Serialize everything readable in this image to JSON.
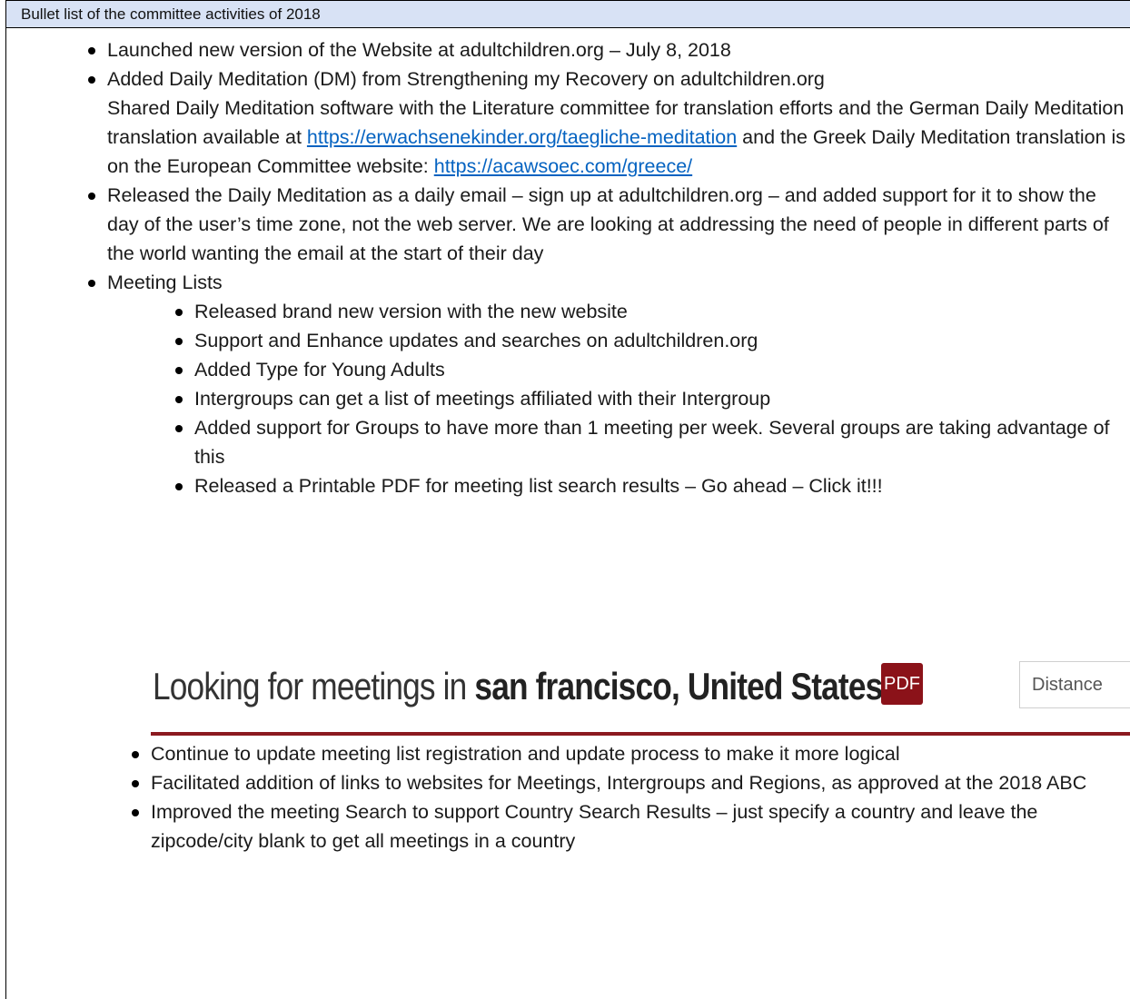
{
  "header": "Bullet list of the committee activities of 2018",
  "items": {
    "website": "Launched new version of the Website at adultchildren.org – July 8, 2018",
    "dm_line1": "Added Daily Meditation (DM) from Strengthening my Recovery on adultchildren.org",
    "dm_line2_a": "Shared Daily Meditation software with the Literature committee for translation efforts and the German Daily Meditation translation available at ",
    "dm_link1": "https://erwachsenekinder.org/taegliche-meditation",
    "dm_line2_b": " and the Greek Daily Meditation translation is on the European Committee website: ",
    "dm_link2": "https://acawsoec.com/greece/",
    "email": "Released the Daily Meditation as a daily email – sign up at adultchildren.org – and added support for it to show the day of the user’s time zone, not the web server. We are looking at addressing the need of people in different parts of the world wanting the email at the start of their day",
    "meeting_lists": "Meeting Lists"
  },
  "sub_items": [
    "Released brand new version with the new website",
    "Support and Enhance updates and searches on adultchildren.org",
    "Added Type for Young Adults",
    "Intergroups can get a list of meetings affiliated with their Intergroup",
    "Added support for Groups to have more than 1 meeting per week. Several groups are taking advantage of this",
    "Released a Printable PDF for meeting list search results – Go ahead – Click it!!!"
  ],
  "banner": {
    "prefix": "Looking for meetings in ",
    "location": "san francisco, United States",
    "pdf_label": "PDF",
    "distance_label": "Distance"
  },
  "sub_items_after": [
    "Continue to update meeting list registration and update process to make it more logical",
    "Facilitated addition of links to websites for Meetings, Intergroups and Regions, as approved at the 2018 ABC",
    "Improved the meeting Search to support Country Search Results – just specify a country and leave the zipcode/city blank to get all meetings in a country"
  ]
}
